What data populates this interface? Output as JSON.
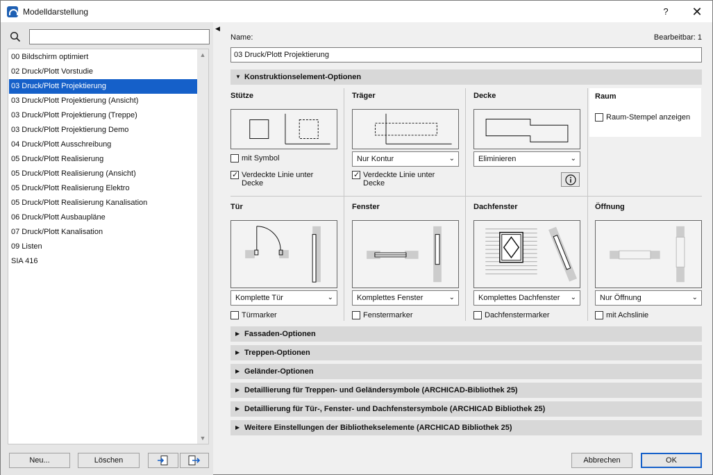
{
  "window": {
    "title": "Modelldarstellung",
    "help_label": "?",
    "close_label": "✕"
  },
  "left": {
    "search_placeholder": "",
    "items": [
      "00 Bildschirm optimiert",
      "02 Druck/Plott Vorstudie",
      "03 Druck/Plott Projektierung",
      "03 Druck/Plott Projektierung (Ansicht)",
      "03 Druck/Plott Projektierung (Treppe)",
      "03 Druck/Plott Projektierung Demo",
      "04 Druck/Plott Ausschreibung",
      "05 Druck/Plott Realisierung",
      "05 Druck/Plott Realisierung (Ansicht)",
      "05 Druck/Plott Realisierung Elektro",
      "05 Druck/Plott Realisierung Kanalisation",
      "06 Druck/Plott Ausbaupläne",
      "07 Druck/Plott Kanalisation",
      "09 Listen",
      "SIA 416"
    ],
    "selected_index": 2,
    "buttons": {
      "new": "Neu...",
      "delete": "Löschen"
    }
  },
  "main": {
    "name_label": "Name:",
    "editable_label": "Bearbeitbar: 1",
    "name_value": "03 Druck/Plott Projektierung",
    "construction_header": "Konstruktionselement-Optionen",
    "stuetze": {
      "title": "Stütze",
      "symbol_label": "mit Symbol",
      "symbol_checked": false,
      "hidden_line_label": "Verdeckte Linie unter Decke",
      "hidden_line_checked": true
    },
    "traeger": {
      "title": "Träger",
      "dropdown": "Nur Kontur",
      "hidden_line_label": "Verdeckte Linie unter Decke",
      "hidden_line_checked": true
    },
    "decke": {
      "title": "Decke",
      "dropdown": "Eliminieren",
      "info_icon": "info-icon"
    },
    "raum": {
      "title": "Raum",
      "stamp_label": "Raum-Stempel anzeigen",
      "stamp_checked": false
    },
    "tuer": {
      "title": "Tür",
      "dropdown": "Komplette Tür",
      "marker_label": "Türmarker",
      "marker_checked": false
    },
    "fenster": {
      "title": "Fenster",
      "dropdown": "Komplettes Fenster",
      "marker_label": "Fenstermarker",
      "marker_checked": false
    },
    "dachfenster": {
      "title": "Dachfenster",
      "dropdown": "Komplettes Dachfenster",
      "marker_label": "Dachfenstermarker",
      "marker_checked": false
    },
    "oeffnung": {
      "title": "Öffnung",
      "dropdown": "Nur Öffnung",
      "axis_label": "mit Achslinie",
      "axis_checked": false
    },
    "collapsed_sections": [
      "Fassaden-Optionen",
      "Treppen-Optionen",
      "Geländer-Optionen",
      "Detaillierung für Treppen- und Geländersymbole (ARCHICAD-Bibliothek 25)",
      "Detaillierung für Tür-, Fenster- und Dachfenstersymbole (ARCHICAD Bibliothek 25)",
      "Weitere Einstellungen der Bibliothekselemente (ARCHICAD Bibliothek 25)"
    ]
  },
  "footer": {
    "cancel": "Abbrechen",
    "ok": "OK"
  }
}
